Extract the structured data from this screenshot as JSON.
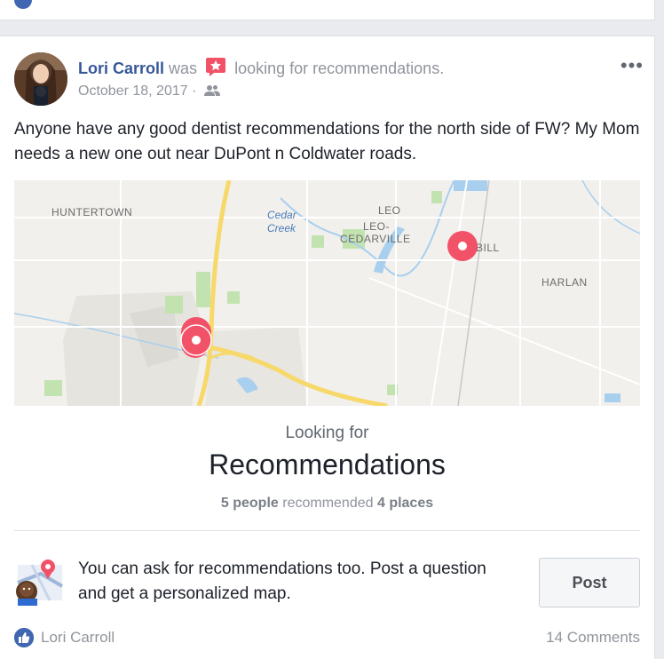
{
  "post": {
    "author": "Lori Carroll",
    "activity_prefix": "was",
    "activity": "looking for recommendations.",
    "date": "October 18, 2017",
    "separator": "·",
    "more": "•••",
    "text": "Anyone have any good dentist recommendations for the north side of FW? My Mom needs a new one out near DuPont n Coldwater roads."
  },
  "map": {
    "labels": {
      "huntertown": "HUNTERTOWN",
      "cedar": "Cedar",
      "creek": "Creek",
      "leo": "LEO",
      "leo_dash": "LEO-",
      "cedarville": "CEDARVILLE",
      "grabill": "BILL",
      "harlan": "HARLAN"
    }
  },
  "recommendations": {
    "looking_for": "Looking for",
    "title": "Recommendations",
    "people_count": "5 people",
    "recommended_word": "recommended",
    "places_count": "4 places"
  },
  "promo": {
    "text": "You can ask for recommendations too. Post a question and get a personalized map.",
    "button": "Post"
  },
  "footer": {
    "liker": "Lori Carroll",
    "comments": "14 Comments"
  },
  "colors": {
    "link": "#365899",
    "pin": "#f25268",
    "like": "#4267b2"
  }
}
